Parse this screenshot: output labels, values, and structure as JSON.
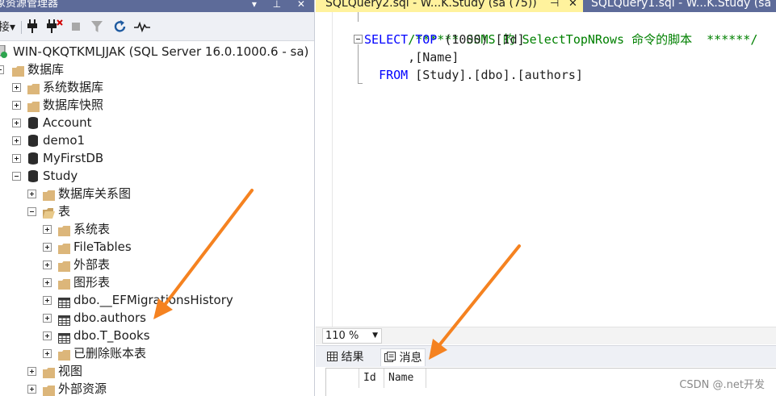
{
  "object_explorer": {
    "title": "象资源管理器",
    "title_buttons": "▾ ⊥ ✕",
    "toolbar": {
      "connect_label": "接▾"
    },
    "server_node": "WIN-QKQTKMLJJAK (SQL Server 16.0.1000.6 - sa)",
    "tree": [
      {
        "label": "数据库"
      },
      {
        "label": "系统数据库"
      },
      {
        "label": "数据库快照"
      },
      {
        "label": "Account"
      },
      {
        "label": "demo1"
      },
      {
        "label": "MyFirstDB"
      },
      {
        "label": "Study"
      },
      {
        "label": "数据库关系图"
      },
      {
        "label": "表"
      },
      {
        "label": "系统表"
      },
      {
        "label": "FileTables"
      },
      {
        "label": "外部表"
      },
      {
        "label": "图形表"
      },
      {
        "label": "dbo.__EFMigrationsHistory"
      },
      {
        "label": "dbo.authors"
      },
      {
        "label": "dbo.T_Books"
      },
      {
        "label": "已删除账本表"
      },
      {
        "label": "视图"
      },
      {
        "label": "外部资源"
      }
    ]
  },
  "editor": {
    "tabs": [
      {
        "label": "SQLQuery2.sql - W...K.Study (sa (75))",
        "pin": "⊣",
        "close": "✕"
      },
      {
        "label": "SQLQuery1.sql - W...K.Study (sa"
      }
    ],
    "code": {
      "comment": "/****** SSMS 的 SelectTopNRows 命令的脚本  ******/",
      "line2_kw1": "SELECT",
      "line2_kw2": "TOP",
      "line2_rest": " (1000) [Id]",
      "line3": "      ,[Name]",
      "line4_kw": "FROM",
      "line4_rest": " [Study].[dbo].[authors]"
    },
    "zoom": "110 %",
    "results_tabs": [
      {
        "label": "结果"
      },
      {
        "label": "消息"
      }
    ],
    "grid_columns": [
      "Id",
      "Name"
    ]
  },
  "watermark": "CSDN @.net开发",
  "colors": {
    "accent_tab": "#fff29d",
    "title_bar": "#5d6b99",
    "arrow": "#f58220",
    "keyword": "#0000ff",
    "comment": "#008000"
  }
}
